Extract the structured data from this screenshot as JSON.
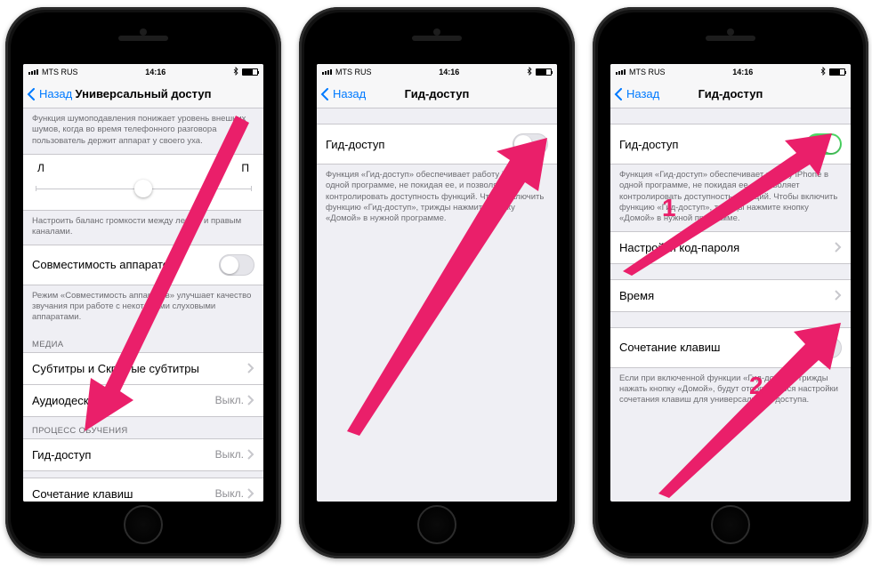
{
  "status": {
    "carrier": "MTS RUS",
    "time": "14:16"
  },
  "nav": {
    "back": "Назад"
  },
  "colors": {
    "accent_blue": "#007aff",
    "toggle_green": "#4cd964",
    "arrow_pink": "#ea1f6a"
  },
  "screen1": {
    "title": "Универсальный доступ",
    "noise_note": "Функция шумоподавления понижает уровень внешних шумов, когда во время телефонного разговора пользователь держит аппарат у своего уха.",
    "balance_left": "Л",
    "balance_right": "П",
    "balance_note": "Настроить баланс громкости между левым и правым каналами.",
    "hearing_compat": "Совместимость аппаратов",
    "compat_note": "Режим «Совместимость аппаратов» улучшает качество звучания при работе с некоторыми слуховыми аппаратами.",
    "hdr_media": "МЕДИА",
    "subtitles": "Субтитры и Скрытые субтитры",
    "audiodesc": "Аудиодескрипция",
    "audiodesc_val": "Выкл.",
    "hdr_learning": "ПРОЦЕСС ОБУЧЕНИЯ",
    "guided": "Гид-доступ",
    "guided_val": "Выкл.",
    "shortcut": "Сочетание клавиш",
    "shortcut_val": "Выкл."
  },
  "screen2": {
    "title": "Гид-доступ",
    "toggle_label": "Гид-доступ",
    "note": "Функция «Гид-доступ» обеспечивает работу iPhone в одной программе, не покидая ее, и позволяет контролировать доступность функций. Чтобы включить функцию «Гид-доступ», трижды нажмите кнопку «Домой» в нужной программе."
  },
  "screen3": {
    "title": "Гид-доступ",
    "toggle_label": "Гид-доступ",
    "note": "Функция «Гид-доступ» обеспечивает работу iPhone в одной программе, не покидая ее, и позволяет контролировать доступность функций. Чтобы включить функцию «Гид-доступ», трижды нажмите кнопку «Домой» в нужной программе.",
    "passcode": "Настройки код-пароля",
    "time": "Время",
    "shortcut": "Сочетание клавиш",
    "shortcut_note": "Если при включенной функции «Гид-доступ» трижды нажать кнопку «Домой», будут отображаться настройки сочетания клавиш для универсального доступа."
  },
  "annotations": {
    "n1": "1",
    "n2": "2"
  }
}
